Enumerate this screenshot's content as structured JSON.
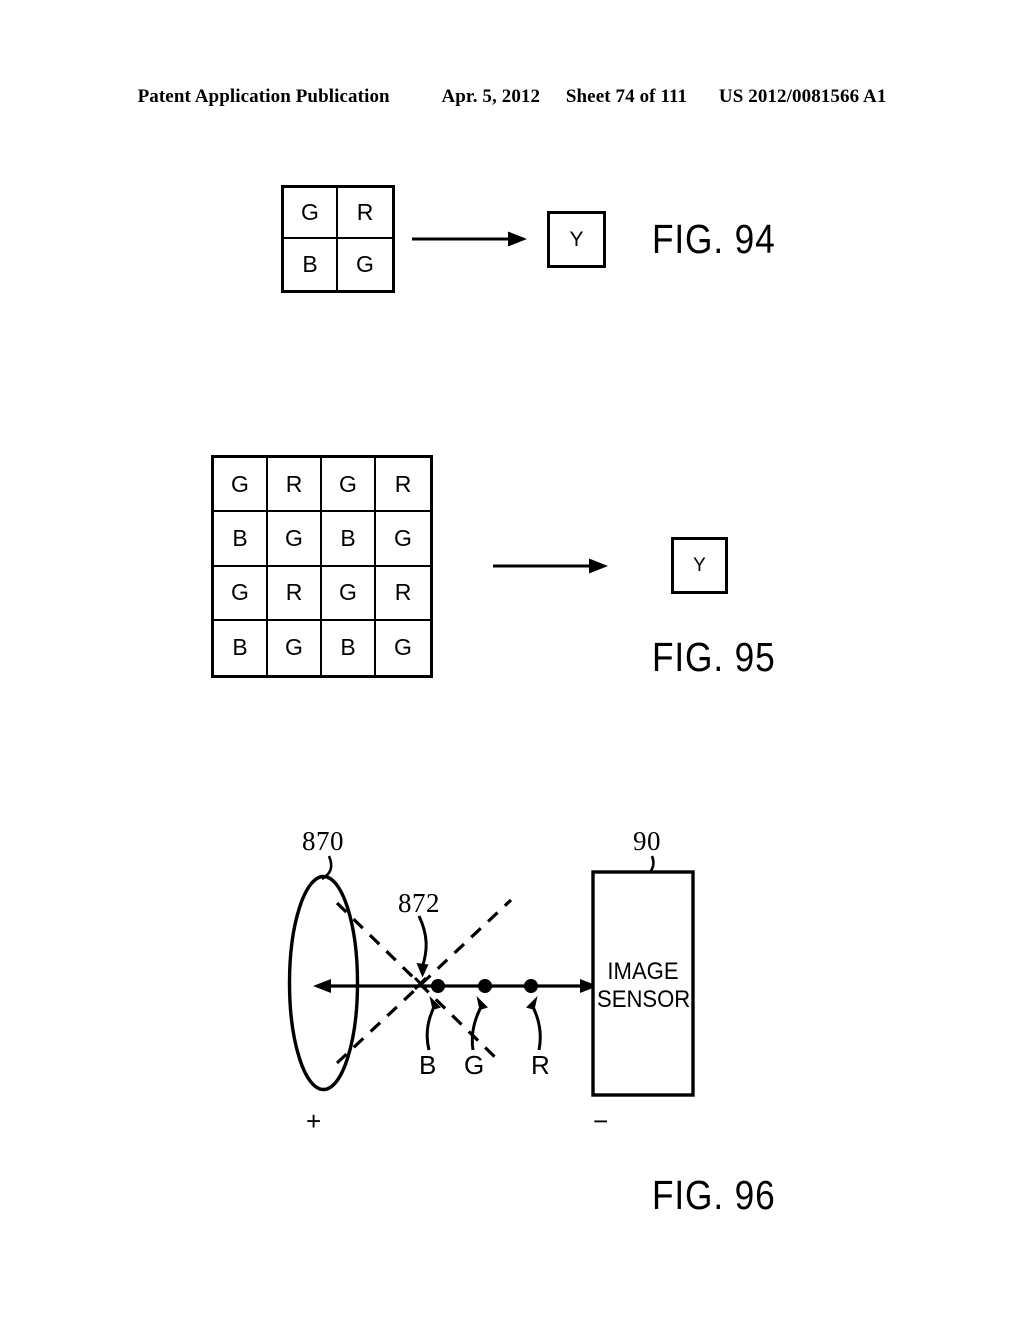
{
  "header": {
    "publication": "Patent Application Publication",
    "date": "Apr. 5, 2012",
    "sheet": "Sheet 74 of 111",
    "document_number": "US 2012/0081566 A1"
  },
  "figures": [
    {
      "id": "fig-94",
      "caption": "FIG. 94",
      "grid": {
        "columns": 2,
        "rows": 2,
        "cells": [
          [
            "G",
            "R"
          ],
          [
            "B",
            "G"
          ]
        ]
      },
      "arrow": {
        "name": "transform-arrow"
      },
      "output_box": {
        "label": "Y"
      }
    },
    {
      "id": "fig-95",
      "caption": "FIG. 95",
      "grid": {
        "columns": 4,
        "rows": 4,
        "cells": [
          [
            "G",
            "R",
            "G",
            "R"
          ],
          [
            "B",
            "G",
            "B",
            "G"
          ],
          [
            "G",
            "R",
            "G",
            "R"
          ],
          [
            "B",
            "G",
            "B",
            "G"
          ]
        ]
      },
      "arrow": {
        "name": "transform-arrow"
      },
      "output_box": {
        "label": "Y"
      }
    },
    {
      "id": "fig-96",
      "caption": "FIG. 96",
      "reference_numerals": {
        "lens": "870",
        "focal_point": "872",
        "image_sensor": "90"
      },
      "sensor_label_line1": "IMAGE",
      "sensor_label_line2": "SENSOR",
      "focus_points": [
        {
          "label": "B"
        },
        {
          "label": "G"
        },
        {
          "label": "R"
        }
      ],
      "polarity": {
        "positive": "+",
        "negative": "−"
      }
    }
  ],
  "colors": {
    "ink": "#000000",
    "paper": "#ffffff"
  }
}
